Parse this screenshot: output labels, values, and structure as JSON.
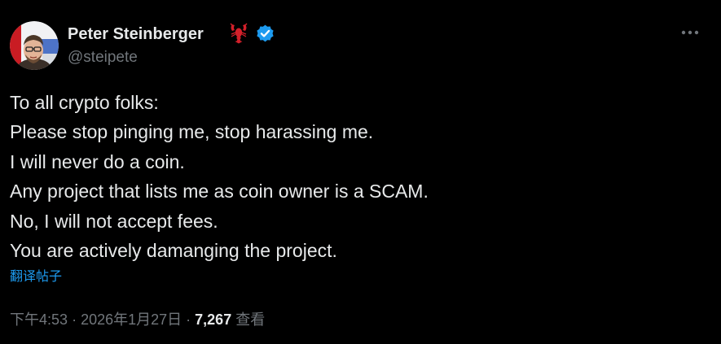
{
  "tweet": {
    "author": {
      "display_name": "Peter Steinberger",
      "handle": "@steipete",
      "emoji_icon": "lobster-icon",
      "verified_icon": "verified-badge-icon",
      "verified_color": "#1d9bf0"
    },
    "more_icon": "more-horizontal-icon",
    "lines": [
      "To all crypto folks:",
      "Please stop pinging me, stop harassing me.",
      "I will never do a coin.",
      "Any project that lists me as coin owner is a SCAM.",
      "No, I will not accept fees.",
      "You are actively damanging the project."
    ],
    "translate_label": "翻译帖子",
    "time": "下午4:53",
    "separator": "·",
    "date": "2026年1月27日",
    "views_count": "7,267",
    "views_label": "查看"
  },
  "colors": {
    "background": "#000000",
    "text_primary": "#e7e9ea",
    "text_secondary": "#71767b",
    "accent": "#1d9bf0"
  }
}
